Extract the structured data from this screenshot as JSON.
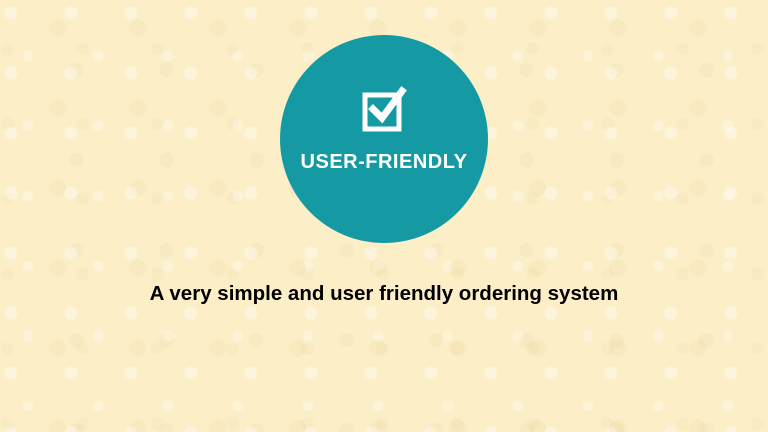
{
  "badge": {
    "label": "USER-FRIENDLY",
    "icon": "checkbox-checked-icon",
    "color": "#1599a3"
  },
  "caption": "A very simple and user friendly ordering system",
  "background_color": "#fcefc8"
}
